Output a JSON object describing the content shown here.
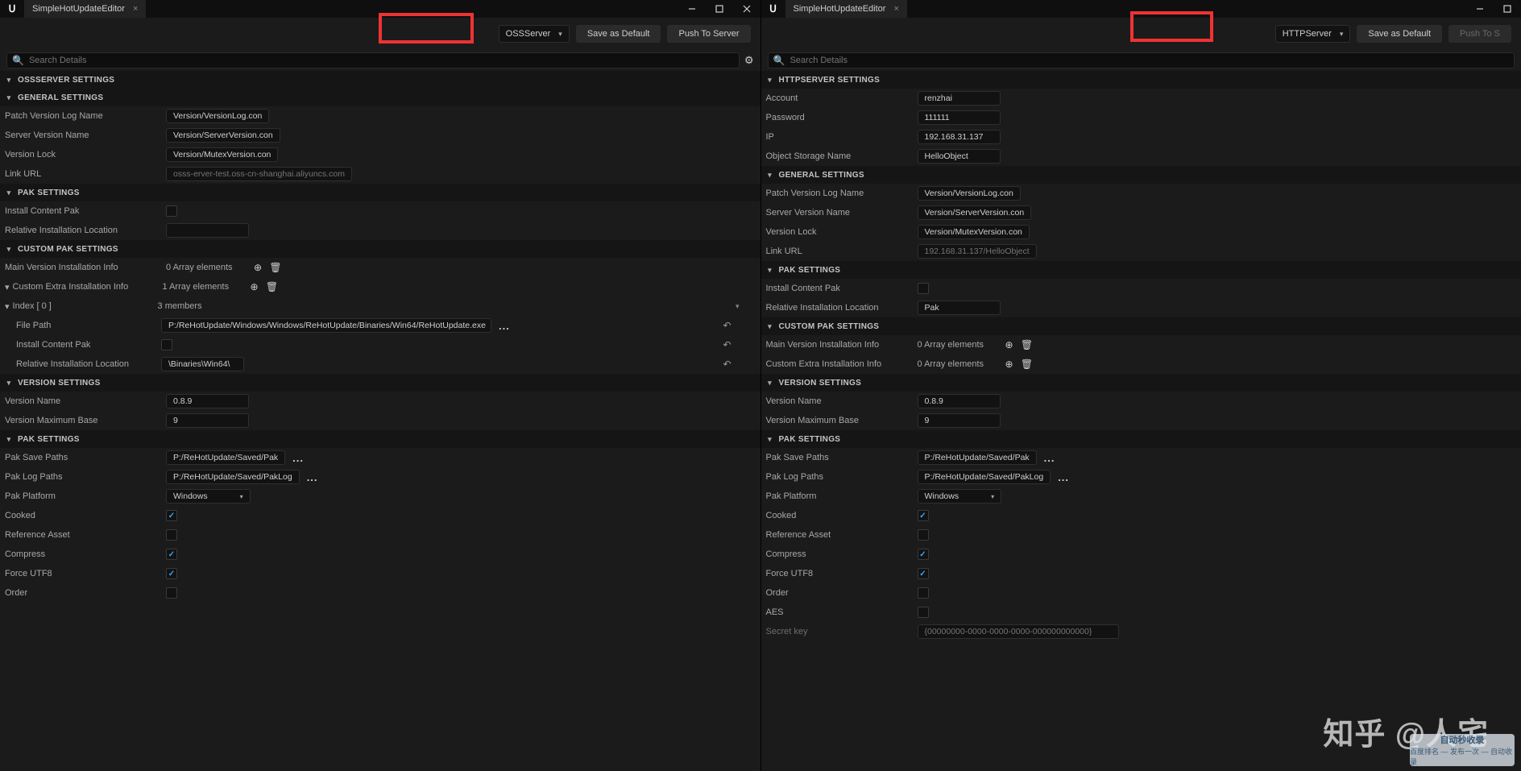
{
  "left": {
    "title": "SimpleHotUpdateEditor",
    "server_dropdown": "OSSServer",
    "save_default": "Save as Default",
    "push": "Push To Server",
    "search_ph": "Search Details",
    "sections": {
      "ossserver": "OSSSERVER SETTINGS",
      "general": "GENERAL SETTINGS",
      "pak1": "PAK SETTINGS",
      "custom": "CUSTOM PAK SETTINGS",
      "version": "VERSION SETTINGS",
      "pak2": "PAK SETTINGS"
    },
    "general_rows": {
      "patch_label": "Patch Version Log Name",
      "patch_val": "Version/VersionLog.con",
      "server_label": "Server Version Name",
      "server_val": "Version/ServerVersion.con",
      "lock_label": "Version Lock",
      "lock_val": "Version/MutexVersion.con",
      "link_label": "Link URL",
      "link_val": "osss-erver-test.oss-cn-shanghai.aliyuncs.com"
    },
    "pak1_rows": {
      "install_label": "Install Content Pak",
      "rel_label": "Relative Installation Location"
    },
    "custom_rows": {
      "main_label": "Main Version Installation Info",
      "main_val": "0 Array elements",
      "extra_label": "Custom Extra Installation Info",
      "extra_val": "1 Array elements",
      "index_label": "Index [ 0 ]",
      "index_val": "3 members",
      "fp_label": "File Path",
      "fp_val": "P:/ReHotUpdate/Windows/Windows/ReHotUpdate/Binaries/Win64/ReHotUpdate.exe",
      "icp_label": "Install Content Pak",
      "ril_label": "Relative Installation Location",
      "ril_val": "\\Binaries\\Win64\\"
    },
    "version_rows": {
      "name_label": "Version Name",
      "name_val": "0.8.9",
      "max_label": "Version Maximum Base",
      "max_val": "9"
    },
    "pak2_rows": {
      "save_label": "Pak Save Paths",
      "save_val": "P:/ReHotUpdate/Saved/Pak",
      "log_label": "Pak Log Paths",
      "log_val": "P:/ReHotUpdate/Saved/PakLog",
      "plat_label": "Pak Platform",
      "plat_val": "Windows",
      "cook_label": "Cooked",
      "ref_label": "Reference Asset",
      "comp_label": "Compress",
      "utf_label": "Force UTF8",
      "order_label": "Order"
    }
  },
  "right": {
    "title": "SimpleHotUpdateEditor",
    "server_dropdown": "HTTPServer",
    "save_default": "Save as Default",
    "push": "Push To S",
    "search_ph": "Search Details",
    "sections": {
      "http": "HTTPSERVER SETTINGS",
      "general": "GENERAL SETTINGS",
      "pak1": "PAK SETTINGS",
      "custom": "CUSTOM PAK SETTINGS",
      "version": "VERSION SETTINGS",
      "pak2": "PAK SETTINGS"
    },
    "http_rows": {
      "acc_label": "Account",
      "acc_val": "renzhai",
      "pwd_label": "Password",
      "pwd_val": "111111",
      "ip_label": "IP",
      "ip_val": "192.168.31.137",
      "obj_label": "Object Storage Name",
      "obj_val": "HelloObject"
    },
    "general_rows": {
      "patch_label": "Patch Version Log Name",
      "patch_val": "Version/VersionLog.con",
      "server_label": "Server Version Name",
      "server_val": "Version/ServerVersion.con",
      "lock_label": "Version Lock",
      "lock_val": "Version/MutexVersion.con",
      "link_label": "Link URL",
      "link_val": "192.168.31.137/HelloObject"
    },
    "pak1_rows": {
      "install_label": "Install Content Pak",
      "rel_label": "Relative Installation Location",
      "rel_val": "Pak"
    },
    "custom_rows": {
      "main_label": "Main Version Installation Info",
      "main_val": "0 Array elements",
      "extra_label": "Custom Extra Installation Info",
      "extra_val": "0 Array elements"
    },
    "version_rows": {
      "name_label": "Version Name",
      "name_val": "0.8.9",
      "max_label": "Version Maximum Base",
      "max_val": "9"
    },
    "pak2_rows": {
      "save_label": "Pak Save Paths",
      "save_val": "P:/ReHotUpdate/Saved/Pak",
      "log_label": "Pak Log Paths",
      "log_val": "P:/ReHotUpdate/Saved/PakLog",
      "plat_label": "Pak Platform",
      "plat_val": "Windows",
      "cook_label": "Cooked",
      "ref_label": "Reference Asset",
      "comp_label": "Compress",
      "utf_label": "Force UTF8",
      "order_label": "Order",
      "aes_label": "AES",
      "secret_label": "Secret key",
      "secret_val": "{00000000-0000-0000-0000-000000000000}"
    }
  },
  "watermark": "知乎 @人宅",
  "corner": {
    "t1": "自动秒收录",
    "t2": "百度排名 — 发布一次 — 自动收录"
  }
}
